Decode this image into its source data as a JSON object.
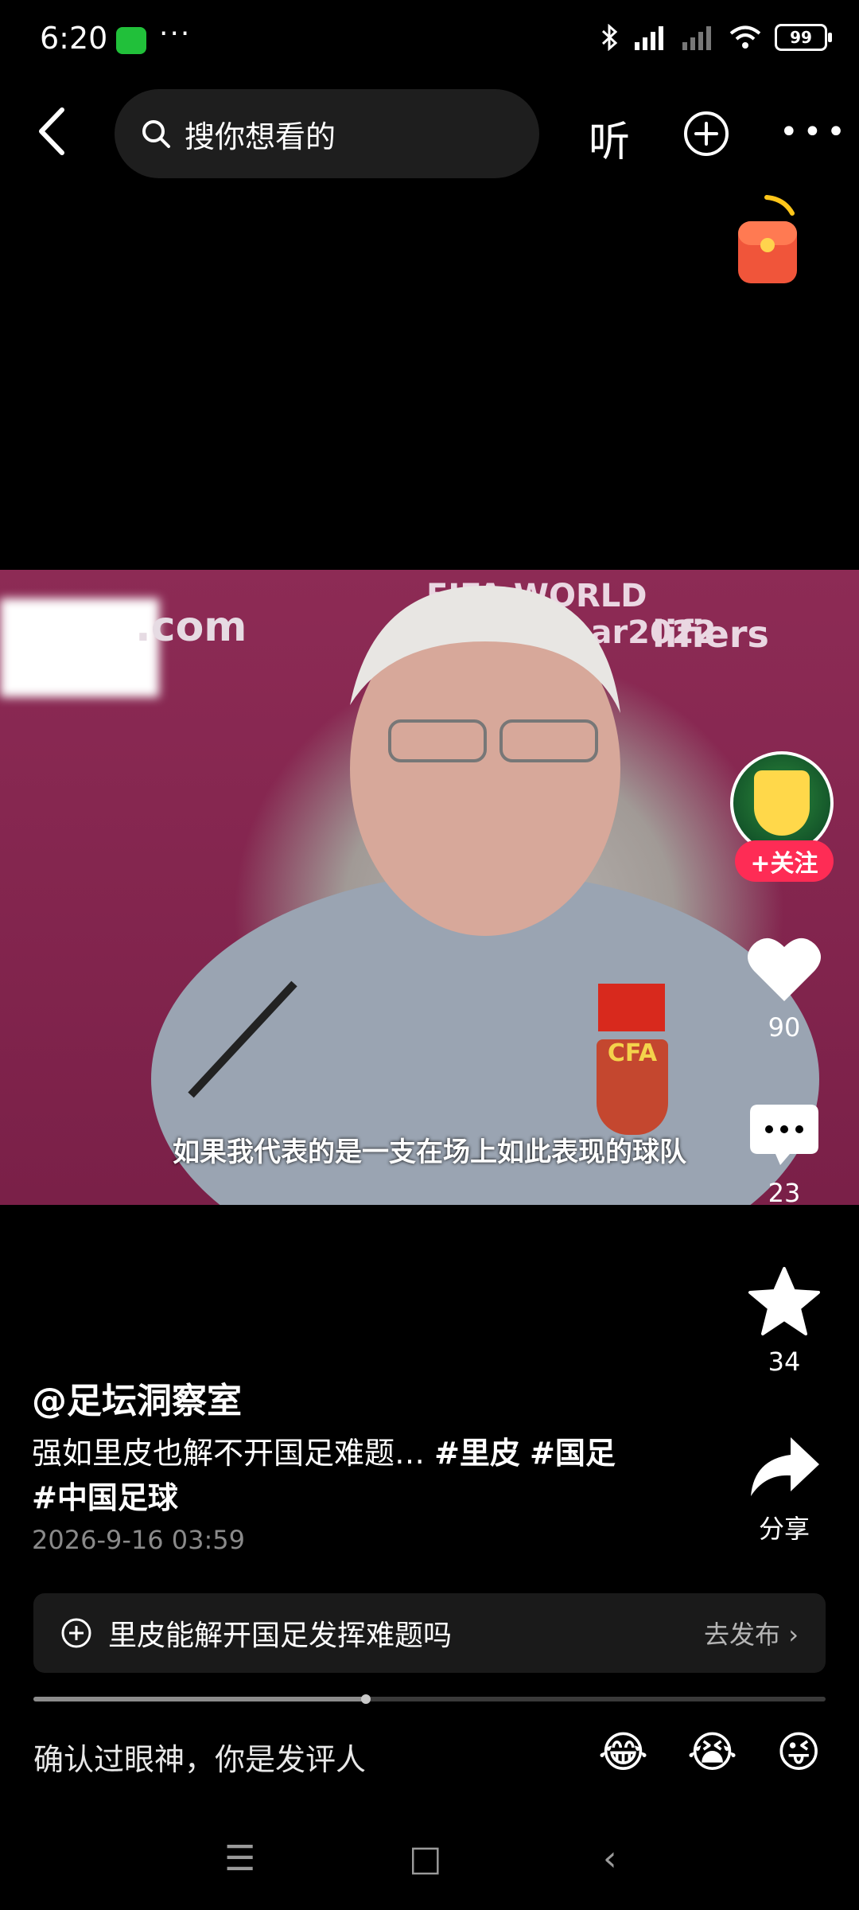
{
  "status_bar": {
    "time": "6:20",
    "dots": "···",
    "battery": "99"
  },
  "top_nav": {
    "search_placeholder": "搜你想看的",
    "listen_label": "听"
  },
  "video": {
    "watermark": ".com",
    "fifa_text": "FIFA WORLD CUP·Qat_ar2022",
    "qualifiers_text": "lifiers",
    "cfa_text": "CFA",
    "subtitle": "如果我代表的是一支在场上如此表现的球队"
  },
  "actions": {
    "follow_label": "+关注",
    "likes": "90",
    "comments": "23",
    "favorites": "34",
    "share_label": "分享"
  },
  "post": {
    "author": "@足坛洞察室",
    "text": "强如里皮也解不开国足难题… ",
    "tags": [
      "#里皮",
      "#国足",
      "#中国足球"
    ],
    "date": "2026-9-16 03:59"
  },
  "topic": {
    "text": "里皮能解开国足发挥难题吗",
    "action": "去发布"
  },
  "progress": {
    "fraction": 0.42
  },
  "comment": {
    "prompt": "确认过眼神，你是发评人",
    "emojis": [
      "😂",
      "😭",
      "😜"
    ]
  },
  "system_nav": {
    "menu": "☰",
    "home": "□",
    "back": "‹"
  }
}
